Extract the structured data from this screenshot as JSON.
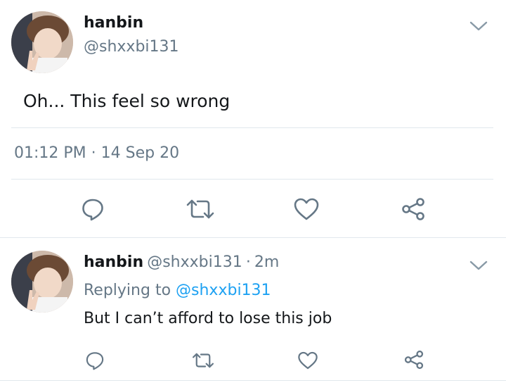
{
  "tweet": {
    "author_name": "hanbin",
    "author_handle": "@shxxbi131",
    "text": "Oh... This feel so wrong",
    "time": "01:12 PM",
    "separator": "·",
    "date": "14 Sep 20",
    "icons": [
      "reply-icon",
      "retweet-icon",
      "like-icon",
      "share-icon"
    ]
  },
  "reply": {
    "author_name": "hanbin",
    "author_handle": "@shxxbi131",
    "separator": "·",
    "age": "2m",
    "replying_label": "Replying to",
    "replying_handle": "@shxxbi131",
    "text": "But I can’t afford to lose this job",
    "icons": [
      "reply-icon",
      "retweet-icon",
      "like-icon",
      "share-icon"
    ]
  },
  "colors": {
    "primary_text": "#14171a",
    "secondary_text": "#657786",
    "link": "#1da1f2",
    "divider": "#e1e8ed"
  }
}
